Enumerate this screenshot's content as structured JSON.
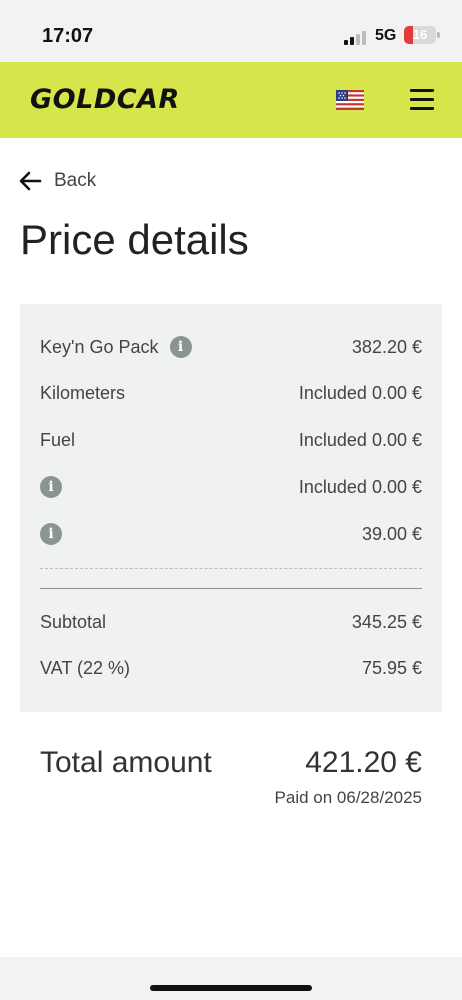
{
  "status_bar": {
    "time": "17:07",
    "network": "5G",
    "battery": "16"
  },
  "header": {
    "logo": "GOLDCAR",
    "flag_icon": "us-flag-icon",
    "menu_icon": "hamburger-menu-icon",
    "brand_color": "#d6e64a"
  },
  "nav": {
    "back_label": "Back"
  },
  "page": {
    "title": "Price details"
  },
  "price_lines": [
    {
      "label": "Key'n Go Pack",
      "has_info": true,
      "value": "382.20 €"
    },
    {
      "label": "Kilometers",
      "has_info": false,
      "value": "Included 0.00 €"
    },
    {
      "label": "Fuel",
      "has_info": false,
      "value": "Included 0.00 €"
    },
    {
      "label": "",
      "has_info": true,
      "value": "Included 0.00 €"
    },
    {
      "label": "",
      "has_info": true,
      "value": "39.00 €"
    }
  ],
  "summary": {
    "subtotal_label": "Subtotal",
    "subtotal_value": "345.25 €",
    "vat_label": "VAT (22 %)",
    "vat_value": "75.95 €"
  },
  "total": {
    "label": "Total amount",
    "value": "421.20 €",
    "paid_on": "Paid on 06/28/2025"
  }
}
